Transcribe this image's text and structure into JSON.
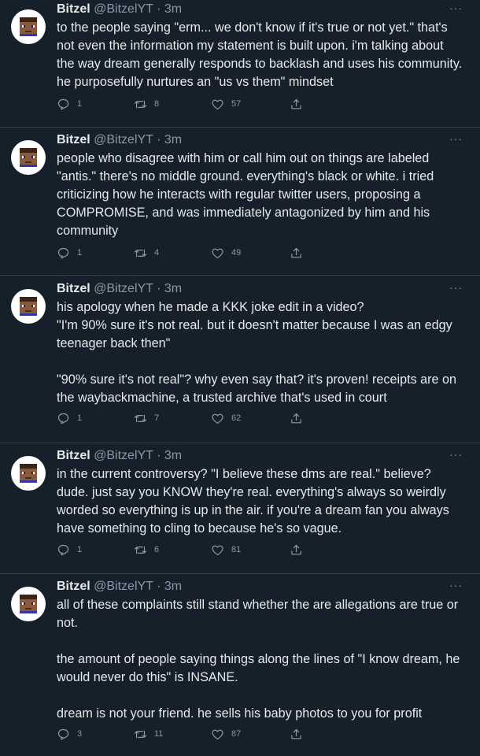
{
  "tweets": [
    {
      "name": "Bitzel",
      "handle": "@BitzelYT",
      "sep": "·",
      "time": "3m",
      "more": "···",
      "text": "to the people saying \"erm... we don't know if it's true or not yet.\" that's\nnot even the information my statement is built upon. i'm talking about\nthe way dream generally responds to backlash and uses his community.\nhe purposefully nurtures an \"us vs them\" mindset",
      "replies": "1",
      "retweets": "8",
      "likes": "57"
    },
    {
      "name": "Bitzel",
      "handle": "@BitzelYT",
      "sep": "·",
      "time": "3m",
      "more": "···",
      "text": "people who disagree with him or call him out on things are labeled\n\"antis.\" there's no middle ground. everything's black or white. i tried\ncriticizing how he interacts with regular twitter users, proposing a\nCOMPROMISE, and was immediately antagonized by him and his\ncommunity",
      "replies": "1",
      "retweets": "4",
      "likes": "49"
    },
    {
      "name": "Bitzel",
      "handle": "@BitzelYT",
      "sep": "·",
      "time": "3m",
      "more": "···",
      "text": "his apology when he made a KKK joke edit in a video?\n\"I'm 90% sure it's not real. but it doesn't matter because I was an edgy\nteenager back then\"\n\n\"90% sure it's not real\"? why even say that? it's proven! receipts are on\nthe waybackmachine, a trusted archive that's used in court",
      "replies": "1",
      "retweets": "7",
      "likes": "62"
    },
    {
      "name": "Bitzel",
      "handle": "@BitzelYT",
      "sep": "·",
      "time": "3m",
      "more": "···",
      "text": "in the current controversy? \"I believe these dms are real.\" believe?\ndude. just say you KNOW they're real. everything's always so weirdly\nworded so everything is up in the air. if you're a dream fan you always\nhave something to cling to because he's so vague.",
      "replies": "1",
      "retweets": "6",
      "likes": "81"
    },
    {
      "name": "Bitzel",
      "handle": "@BitzelYT",
      "sep": "·",
      "time": "3m",
      "more": "···",
      "text": "all of these complaints still stand whether the are allegations are true or\nnot.\n\nthe amount of people saying things along the lines of \"I know dream, he\nwould never do this\" is INSANE.\n\ndream is not your friend. he sells his baby photos to you for profit",
      "replies": "3",
      "retweets": "11",
      "likes": "87"
    }
  ],
  "colors": {
    "background": "#15202b",
    "text": "#e7e9ea",
    "muted": "#8b98a5",
    "divider": "#38444d"
  },
  "icons": [
    "reply-icon",
    "retweet-icon",
    "like-icon",
    "share-icon",
    "more-icon",
    "avatar"
  ]
}
